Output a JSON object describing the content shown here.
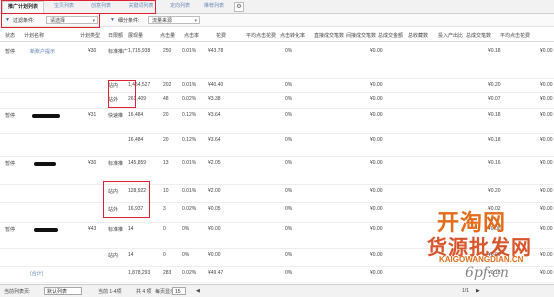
{
  "tabs": [
    {
      "label": "推广计划列表",
      "active": true
    },
    {
      "label": "宝贝列表",
      "active": false
    },
    {
      "label": "创意列表",
      "active": false
    },
    {
      "label": "关键词列表",
      "active": false
    },
    {
      "label": "定向列表",
      "active": false
    },
    {
      "label": "推荐列表",
      "active": false
    }
  ],
  "filter": {
    "label1": "过滤条件:",
    "select1": "请选择",
    "label2": "细分条件:",
    "select2": "流量来源"
  },
  "columns": [
    "状态",
    "计划名称",
    "计划类型",
    "日限额",
    "展现量",
    "点击量",
    "点击率",
    "花费",
    "平均点击花费",
    "点击转化率",
    "直接成交笔数",
    "间接成交笔数",
    "总成交金额",
    "总收藏数",
    "投入产出比",
    "总成交笔数",
    "平均点击花费"
  ],
  "rows": [
    {
      "status": "暂停",
      "name": "新账户提示",
      "type": "标准推广",
      "budget": "¥30",
      "impr": "1,715,938",
      "clicks": "250",
      "ctr": "0.01%",
      "cost": "¥43.78",
      "conv": "0%",
      "amt": "¥0.00",
      "cpc": "¥0.18",
      "roi": "¥0.00"
    },
    {
      "status": "",
      "name": "",
      "type": "站内",
      "budget": "",
      "impr": "1,454,527",
      "clicks": "202",
      "ctr": "0.01%",
      "cost": "¥40.40",
      "conv": "0%",
      "amt": "¥0.00",
      "cpc": "¥0.20",
      "roi": "¥0.00"
    },
    {
      "status": "",
      "name": "",
      "type": "站外",
      "budget": "",
      "impr": "261,409",
      "clicks": "48",
      "ctr": "0.02%",
      "cost": "¥3.38",
      "conv": "0%",
      "amt": "¥0.00",
      "cpc": "¥0.07",
      "roi": "¥0.00"
    },
    {
      "status": "暂停",
      "name": "",
      "type": "快速推",
      "budget": "¥31",
      "impr": "16,484",
      "clicks": "20",
      "ctr": "0.12%",
      "cost": "¥3.64",
      "conv": "0%",
      "amt": "¥0.00",
      "cpc": "¥0.18",
      "roi": "¥0.00"
    },
    {
      "status": "",
      "name": "",
      "type": "",
      "budget": "",
      "impr": "16,484",
      "clicks": "20",
      "ctr": "0.12%",
      "cost": "¥3.64",
      "conv": "0%",
      "amt": "¥0.00",
      "cpc": "¥0.18",
      "roi": "¥0.00"
    },
    {
      "status": "暂停",
      "name": "",
      "type": "标准推",
      "budget": "¥30",
      "impr": "145,859",
      "clicks": "13",
      "ctr": "0.01%",
      "cost": "¥2.05",
      "conv": "0%",
      "amt": "¥0.00",
      "cpc": "¥0.16",
      "roi": "¥0.00"
    },
    {
      "status": "",
      "name": "",
      "type": "站内",
      "budget": "",
      "impr": "128,922",
      "clicks": "10",
      "ctr": "0.01%",
      "cost": "¥2.00",
      "conv": "0%",
      "amt": "¥0.00",
      "cpc": "¥0.20",
      "roi": "¥0.00"
    },
    {
      "status": "",
      "name": "",
      "type": "站外",
      "budget": "",
      "impr": "16,937",
      "clicks": "3",
      "ctr": "0.02%",
      "cost": "¥0.05",
      "conv": "0%",
      "amt": "¥0.00",
      "cpc": "¥0.02",
      "roi": "¥0.00"
    },
    {
      "status": "暂停",
      "name": "",
      "type": "标准推",
      "budget": "¥43",
      "impr": "14",
      "clicks": "0",
      "ctr": "0%",
      "cost": "¥0.00",
      "conv": "0%",
      "amt": "¥0.00",
      "cpc": "¥0.00",
      "roi": "¥0.00"
    },
    {
      "status": "",
      "name": "",
      "type": "站内",
      "budget": "",
      "impr": "14",
      "clicks": "0",
      "ctr": "0%",
      "cost": "¥0.00",
      "conv": "0%",
      "amt": "¥0.00",
      "cpc": "¥0.00",
      "roi": "¥0.00"
    },
    {
      "status": "",
      "name": "(合计)",
      "type": "",
      "budget": "",
      "impr": "1,878,293",
      "clicks": "283",
      "ctr": "0.02%",
      "cost": "¥49.47",
      "conv": "0%",
      "amt": "¥0.00",
      "cpc": "¥0.18",
      "roi": "¥0.00"
    }
  ],
  "footer": {
    "label": "当前列表页:",
    "select": "默认列表",
    "range": "当前 1-4项",
    "pages": "共 4 项",
    "per_page_label": "每页显示",
    "per_page": "15",
    "page_info": "1/1"
  },
  "watermark": {
    "line1": "开淘网",
    "line2": "货源批发网",
    "url": "KAIGOWANGDIAN.CN",
    "domain": "6pf.cn"
  }
}
